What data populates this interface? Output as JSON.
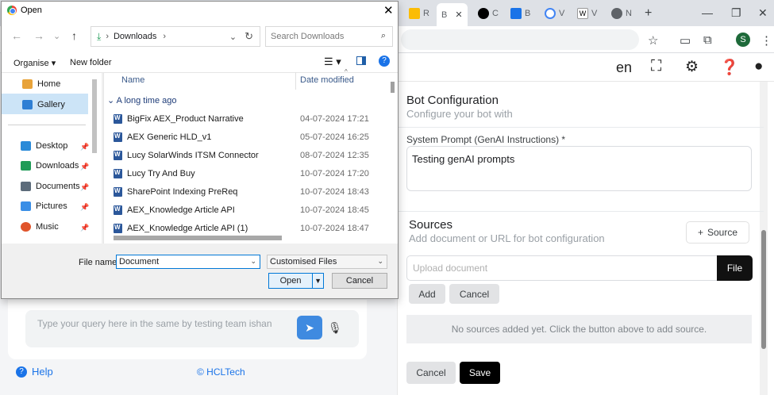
{
  "browser": {
    "tabs": [
      {
        "label": "R",
        "color": "#fbbc05"
      },
      {
        "label": "B",
        "color": "#ffffff"
      },
      {
        "label": "C",
        "color": "#000000"
      },
      {
        "label": "B",
        "color": "#1a73e8"
      },
      {
        "label": "V",
        "color": "#4285f4"
      },
      {
        "label": "V",
        "color": "#ffffff"
      },
      {
        "label": "N",
        "color": "#5f6368"
      }
    ],
    "profile_initial": "S"
  },
  "app": {
    "language": "en",
    "bot_config": {
      "title": "Bot Configuration",
      "subtitle": "Configure your bot with",
      "prompt_label": "System Prompt (GenAI Instructions) *",
      "prompt_value": "Testing genAI prompts"
    },
    "sources": {
      "title": "Sources",
      "subtitle": "Add document or URL for bot configuration",
      "add_source_label": "Source",
      "upload_placeholder": "Upload document",
      "file_label": "File",
      "add_label": "Add",
      "cancel_label": "Cancel",
      "empty_text": "No sources added yet. Click the button above to add source."
    },
    "footer_actions": {
      "cancel_label": "Cancel",
      "save_label": "Save"
    },
    "chat": {
      "placeholder": "Type your query here in the same by testing team ishan",
      "help_label": "Help",
      "copyright": "© HCLTech"
    }
  },
  "dialog": {
    "title": "Open",
    "breadcrumb": "Downloads",
    "search_placeholder": "Search Downloads",
    "commands": {
      "organise": "Organise",
      "new_folder": "New folder"
    },
    "nav_items": [
      {
        "label": "Home",
        "color": "#e8a33a"
      },
      {
        "label": "Gallery",
        "color": "#2f7fd4"
      },
      {
        "label": "Desktop",
        "color": "#2a8ad8"
      },
      {
        "label": "Downloads",
        "color": "#1f9b57"
      },
      {
        "label": "Documents",
        "color": "#5c6b7a"
      },
      {
        "label": "Pictures",
        "color": "#3a8ee6"
      },
      {
        "label": "Music",
        "color": "#e0542b"
      }
    ],
    "columns": {
      "name": "Name",
      "date": "Date modified"
    },
    "group": "A long time ago",
    "files": [
      {
        "name": "BigFix AEX_Product Narrative",
        "date": "04-07-2024 17:21"
      },
      {
        "name": "AEX Generic HLD_v1",
        "date": "05-07-2024 16:25"
      },
      {
        "name": "Lucy SolarWinds ITSM Connector",
        "date": "08-07-2024 12:35"
      },
      {
        "name": "Lucy Try And Buy",
        "date": "10-07-2024 17:20"
      },
      {
        "name": "SharePoint Indexing PreReq",
        "date": "10-07-2024 18:43"
      },
      {
        "name": "AEX_Knowledge Article API",
        "date": "10-07-2024 18:45"
      },
      {
        "name": "AEX_Knowledge Article API (1)",
        "date": "10-07-2024 18:47"
      }
    ],
    "file_name_label": "File name:",
    "file_name_value": "Document",
    "file_type": "Customised Files",
    "open_label": "Open",
    "cancel_label": "Cancel"
  }
}
